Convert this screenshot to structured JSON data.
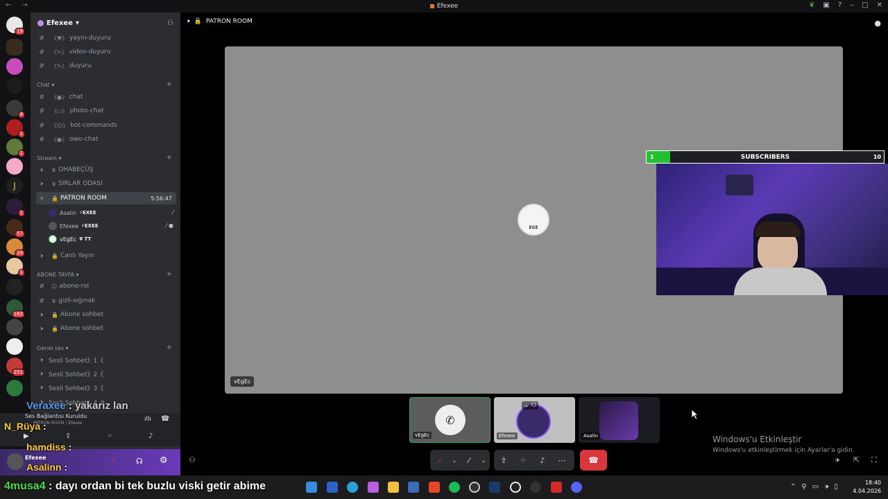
{
  "window": {
    "title": "Efexee"
  },
  "server": {
    "name": "Efexee"
  },
  "channels": {
    "yayin": "yayın-duyuru",
    "video": "video-duyuru",
    "duyuru": "duyuru",
    "cat_chat": "Chat",
    "chat": "chat",
    "photo": "photo-chat",
    "bot": "bot-commands",
    "owo": "owo-chat",
    "cat_stream": "Stream",
    "ohabecus": "OHABEÇÜŞ",
    "sirlar": "SIRLAR ODASI",
    "patron": "PATRON ROOM",
    "patron_timer": "5:56:47",
    "canli": "Canlı Yayın",
    "cat_abone": "ABONE TAYFA",
    "abone_rol": "abone-rol",
    "gizli": "gizli-sığınak",
    "abone1": "Abone sohbet",
    "abone2": "Abone sohbet",
    "cat_genel": "Genel ses",
    "sesli1": "Sesli Sohbet》1《",
    "sesli2": "Sesli Sohbet》2《",
    "sesli3": "Sesli Sohbet》3《",
    "sesli4": "Sesli Sohbet》4《"
  },
  "voice_users": [
    {
      "name": "Asalin",
      "tag": "⚡EXEE"
    },
    {
      "name": "Efexee",
      "tag": "⚡EXEE"
    },
    {
      "name": "vEgEc",
      "tag": "¥ TT"
    }
  ],
  "voice_panel": {
    "status": "Ses Bağlantısı Kuruldu",
    "sub": "PATRON ROOM / Efexee"
  },
  "user_panel": {
    "name": "Efexee"
  },
  "overlay_chat": [
    {
      "user": "Veraxee",
      "sep": ":",
      "text": "yakariz lan"
    },
    {
      "user": "N_Rüya",
      "sep": ":",
      "text": ""
    },
    {
      "user": "hamdiss",
      "sep": ":",
      "text": ""
    },
    {
      "user": "Asalinn",
      "sep": ":",
      "text": ""
    },
    {
      "user": "4musa4",
      "sep": ":",
      "text": "dayı ordan bi tek buzlu viski getir abime"
    }
  ],
  "main": {
    "channel_title": "PATRON ROOM",
    "stage_user": "vEgEc",
    "stage_avatar_text": "EGE"
  },
  "subscribers": {
    "label": "SUBSCRIBERS",
    "current": 1,
    "goal": 10
  },
  "tiles": [
    {
      "name": "vEgEc"
    },
    {
      "name": "Efexee"
    },
    {
      "name": "Asalin"
    }
  ],
  "activation": {
    "title": "Windows'u Etkinleştir",
    "subtitle": "Windows'u etkinleştirmek için Ayarlar'a gidin."
  },
  "clock": {
    "time": "18:40",
    "date": "4.04.2026"
  },
  "server_badges": [
    "19",
    "4",
    "1",
    "1",
    "1",
    "1",
    "57",
    "29",
    "1",
    "162",
    "251"
  ],
  "colors": {
    "accent": "#5865f2",
    "danger": "#da373c",
    "online": "#23a55a",
    "subs_fill": "#22c22f"
  }
}
